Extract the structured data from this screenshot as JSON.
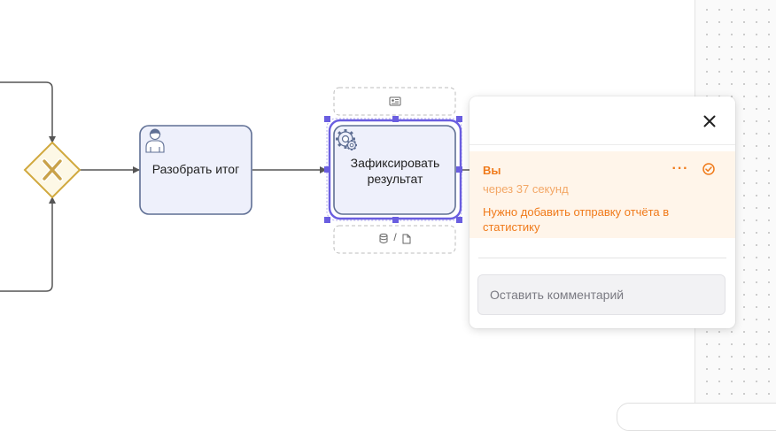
{
  "diagram": {
    "task_analyze_label": "Разобрать итог",
    "task_record_label": "Зафиксировать результат",
    "gateway_icon": "x-icon",
    "user_task_icon": "user-icon",
    "service_task_icon": "gear-icon",
    "upper_placeholder_icon": "id-card-icon",
    "lower_placeholder_icons": [
      "database-icon",
      "file-icon"
    ],
    "lower_placeholder_separator": "/",
    "colors": {
      "task_fill": "#eef0fb",
      "task_border": "#5f6f94",
      "selection": "#6a5ee0",
      "gateway_fill": "#fdf8e6",
      "gateway_border": "#d1a93e",
      "flow": "#555555"
    }
  },
  "comment_popup": {
    "author": "Вы",
    "time": "через 37 секунд",
    "text": "Нужно добавить отправку отчёта в статистику",
    "input_placeholder": "Оставить комментарий",
    "close_icon": "close-icon",
    "more_icon": "more-horizontal-icon",
    "resolve_icon": "check-circle-icon",
    "colors": {
      "accent": "#f07a1a",
      "card_bg": "#fff5ea"
    }
  }
}
